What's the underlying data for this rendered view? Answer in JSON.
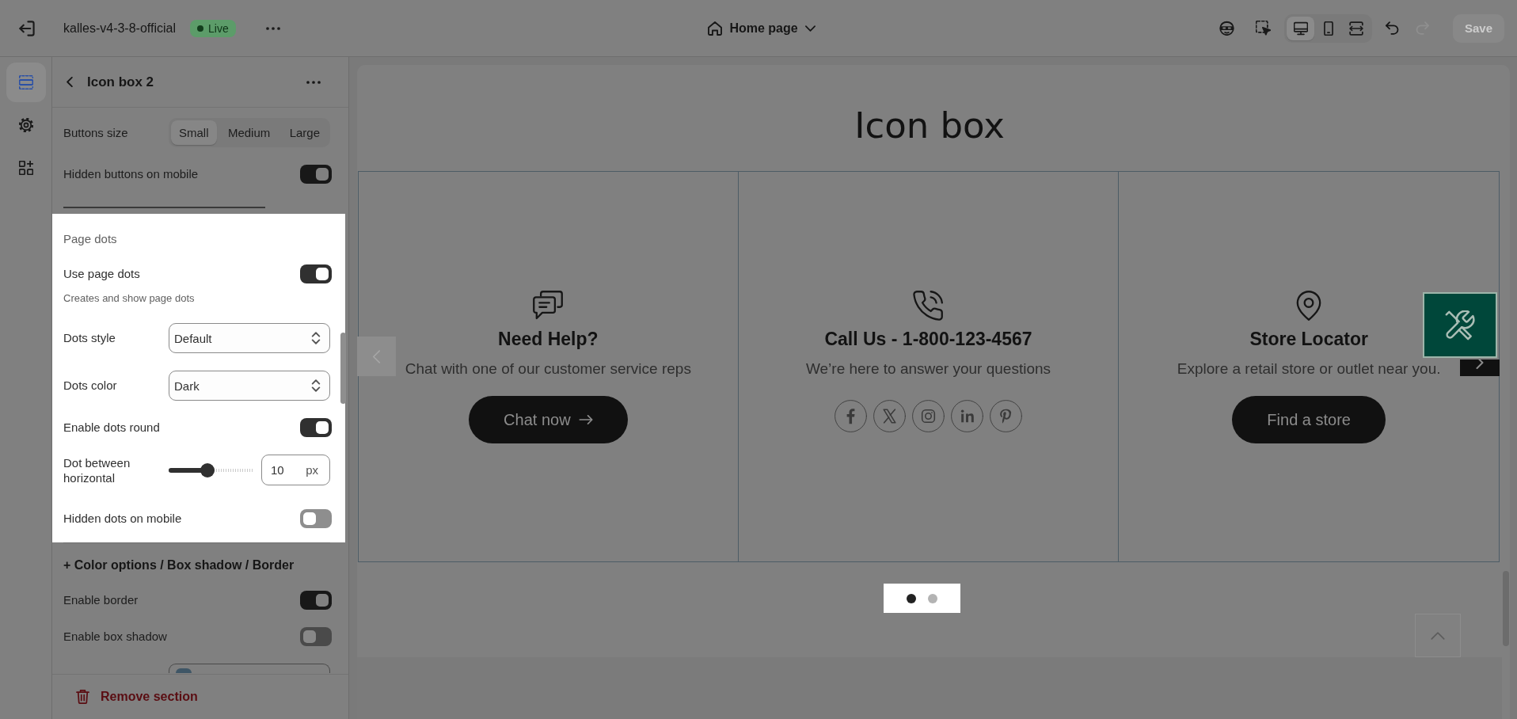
{
  "top_bar": {
    "store_name": "kalles-v4-3-8-official",
    "status": "Live",
    "page": "Home page",
    "tools": [
      {
        "kind": "privacy"
      },
      {
        "kind": "inspect"
      }
    ],
    "view_modes": [
      {
        "kind": "desktop",
        "selected": true
      },
      {
        "kind": "mobile",
        "selected": false
      },
      {
        "kind": "full_width",
        "selected": false
      }
    ],
    "history": [
      {
        "kind": "undo",
        "disabled": false
      },
      {
        "kind": "redo",
        "disabled": true
      }
    ],
    "save": {
      "label": "Save",
      "disabled": true
    }
  },
  "rail": [
    {
      "kind": "sections",
      "selected": true
    },
    {
      "kind": "settings",
      "selected": false
    },
    {
      "kind": "apps",
      "selected": false
    }
  ],
  "panel": {
    "title": "Icon box 2",
    "settings": [
      {
        "kind": "segmented",
        "label": "Buttons size",
        "options": [
          {
            "label": "Small",
            "selected": true
          },
          {
            "label": "Medium",
            "selected": false
          },
          {
            "label": "Large",
            "selected": false
          }
        ]
      },
      {
        "kind": "toggle",
        "label": "Hidden buttons on mobile",
        "on": true
      }
    ],
    "highlighted_group": {
      "heading": "Page dots",
      "settings": [
        {
          "kind": "toggle",
          "label": "Use page dots",
          "on": true,
          "hint": "Creates and show page dots"
        },
        {
          "kind": "select",
          "label": "Dots style",
          "value": "Default"
        },
        {
          "kind": "select",
          "label": "Dots color",
          "value": "Dark"
        },
        {
          "kind": "toggle",
          "label": "Enable dots round",
          "on": true
        },
        {
          "kind": "slider",
          "label": "Dot between horizontal",
          "level": 0.45,
          "value": "10",
          "unit": "px"
        },
        {
          "kind": "toggle",
          "label": "Hidden dots on mobile",
          "on": false
        }
      ]
    },
    "more_group": {
      "heading": "+ Color options / Box shadow / Border",
      "settings": [
        {
          "kind": "toggle",
          "label": "Enable border",
          "on": true
        },
        {
          "kind": "toggle",
          "label": "Enable box shadow",
          "on": false
        },
        {
          "kind": "color_picker"
        }
      ]
    },
    "remove_button": "Remove section"
  },
  "preview": {
    "heading": "Icon box",
    "cards": [
      {
        "kind": "chat",
        "title": "Need Help?",
        "text": "Chat with one of our customer service reps",
        "button": "Chat now",
        "button_arrow": true
      },
      {
        "kind": "phone",
        "title": "Call Us - 1-800-123-4567",
        "text": "We’re here to answer your questions",
        "social_links": [
          {
            "kind": "facebook"
          },
          {
            "kind": "x"
          },
          {
            "kind": "instagram"
          },
          {
            "kind": "linkedin"
          },
          {
            "kind": "pinterest"
          }
        ]
      },
      {
        "kind": "location",
        "title": "Store Locator",
        "text": "Explore a retail store or outlet near you.",
        "button": "Find a store",
        "button_arrow": false
      }
    ],
    "page_dots": [
      {
        "selected": true
      },
      {
        "selected": false
      }
    ]
  }
}
